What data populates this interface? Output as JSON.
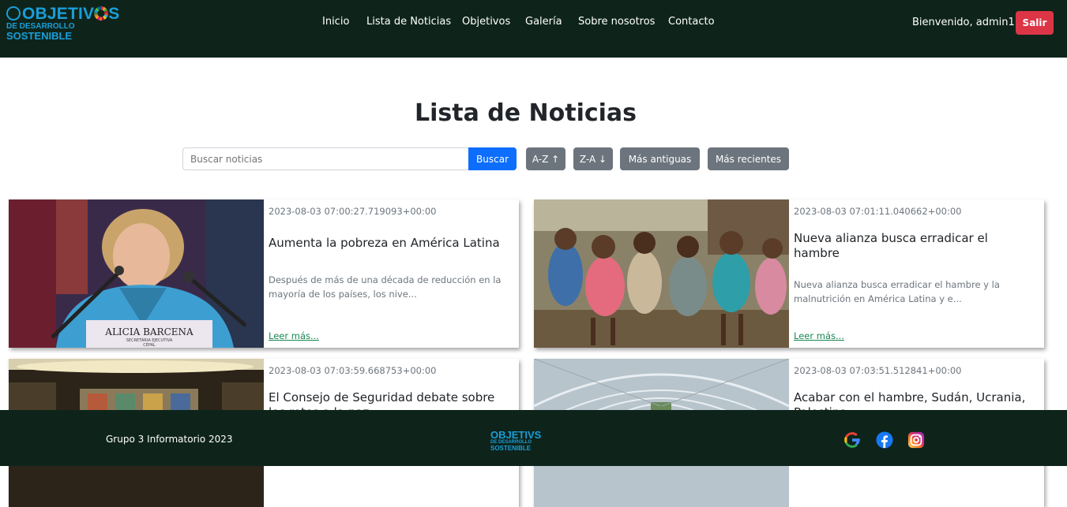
{
  "brand": {
    "line1_a": "OBJETIV",
    "line1_b": "S",
    "line2": "DE DESARROLLO",
    "line3": "SOSTENIBLE"
  },
  "nav": {
    "items": [
      "Inicio",
      "Lista de Noticias",
      "Objetivos",
      "Galería",
      "Sobre nosotros",
      "Contacto"
    ]
  },
  "user": {
    "welcome": "Bienvenido, admin1",
    "logout_label": "Salir"
  },
  "page": {
    "title": "Lista de Noticias"
  },
  "search": {
    "placeholder": "Buscar noticias",
    "button_label": "Buscar"
  },
  "sort": {
    "az": "A-Z ↑",
    "za": "Z-A ↓",
    "oldest": "Más antiguas",
    "newest": "Más recientes"
  },
  "news": [
    {
      "date": "2023-08-03 07:00:27.719093+00:00",
      "title": "Aumenta la pobreza en América Latina",
      "excerpt": "Después de más de una década de reducción en la mayoría de los países, los nive...",
      "link": "Leer más...",
      "nameplate": "ALICIA BARCENA",
      "nameplate_sub": "SECRETARIA EJECUTIVA",
      "nameplate_org": "CEPAL"
    },
    {
      "date": "2023-08-03 07:01:11.040662+00:00",
      "title": "Nueva alianza busca erradicar el hambre",
      "excerpt": "Nueva alianza busca erradicar el hambre y la malnutrición en América Latina y e...",
      "link": "Leer más..."
    },
    {
      "date": "2023-08-03 07:03:59.668753+00:00",
      "title": "El Consejo de Seguridad debate sobre los retos a la paz",
      "excerpt": "",
      "link": ""
    },
    {
      "date": "2023-08-03 07:03:51.512841+00:00",
      "title": "Acabar con el hambre, Sudán, Ucrania, Palestina",
      "excerpt": "",
      "link": ""
    }
  ],
  "footer": {
    "text": "Grupo 3 Informatorio 2023",
    "social": [
      "google-icon",
      "facebook-icon",
      "instagram-icon"
    ]
  },
  "colors": {
    "nav_bg": "#0e241b",
    "logout": "#dc3545",
    "search_btn": "#0d6efd",
    "sort_btn": "#6c757d",
    "link": "#198754",
    "brand": "#1a9ed9"
  }
}
